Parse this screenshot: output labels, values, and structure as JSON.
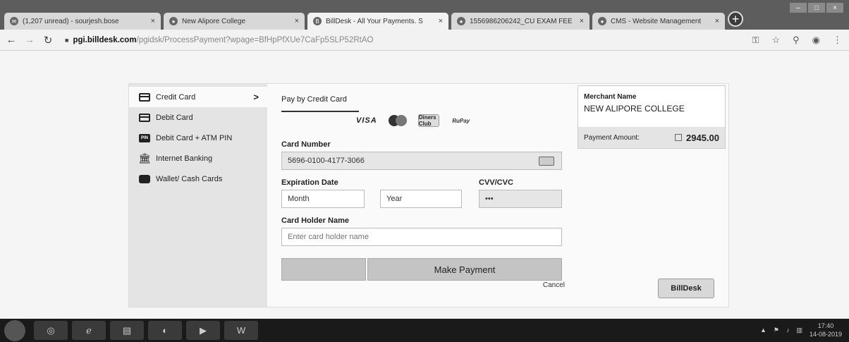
{
  "browser": {
    "tabs": [
      {
        "label": "(1,207 unread) - sourjesh.bose",
        "icon": "mail-icon"
      },
      {
        "label": "New Alipore College",
        "icon": "chrome-icon"
      },
      {
        "label": "BillDesk - All Your Payments. S",
        "icon": "billdesk-icon",
        "active": true
      },
      {
        "label": "1556986206242_CU EXAM FEE",
        "icon": "chrome-icon"
      },
      {
        "label": "CMS - Website Management",
        "icon": "chrome-icon"
      }
    ],
    "url_host": "pgi.billdesk.com",
    "url_path": "/pgidsk/ProcessPayment?wpage=BfHpPfXUe7CaFp5SLP52RtAO"
  },
  "sidebar": {
    "items": [
      {
        "label": "Credit Card",
        "icon": "credit-card-icon",
        "active": true
      },
      {
        "label": "Debit Card",
        "icon": "debit-card-icon"
      },
      {
        "label": "Debit Card + ATM PIN",
        "icon": "atm-pin-icon"
      },
      {
        "label": "Internet Banking",
        "icon": "bank-icon"
      },
      {
        "label": "Wallet/ Cash Cards",
        "icon": "wallet-icon"
      }
    ]
  },
  "form": {
    "tab_label": "Pay by Credit Card",
    "brands": {
      "visa": "VISA",
      "rupay": "RuPay",
      "diners": "Diners Club"
    },
    "card_number_label": "Card Number",
    "card_number_value": "5696-0100-4177-3066",
    "expiry_label": "Expiration Date",
    "month_value": "Month",
    "year_value": "Year",
    "cvv_label": "CVV/CVC",
    "cvv_value": "•••",
    "holder_label": "Card Holder Name",
    "holder_placeholder": "Enter card holder name",
    "pay_button": "Make Payment",
    "cancel": "Cancel"
  },
  "merchant": {
    "heading": "Merchant Name",
    "name": "NEW ALIPORE COLLEGE",
    "amount_label": "Payment Amount:",
    "amount": "2945.00"
  },
  "logo": "BillDesk",
  "taskbar": {
    "time": "17:40",
    "date": "14-08-2019"
  }
}
